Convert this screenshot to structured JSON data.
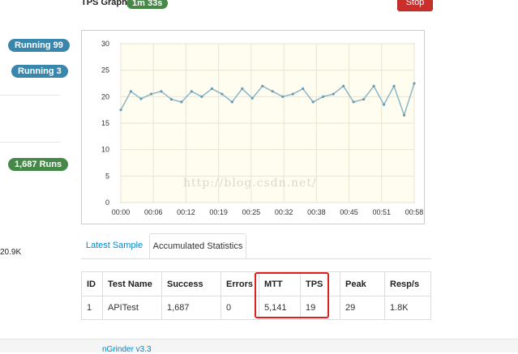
{
  "sidebar": {
    "running_badge_1": "Running 99",
    "running_badge_2": "Running 3",
    "runs_badge": "1,687  Runs",
    "size_text": "20.9K"
  },
  "graph": {
    "title": "TPS Graph",
    "elapsed": "1m 33s",
    "stop_label": "Stop",
    "watermark": "http://blog.csdn.net/"
  },
  "chart_data": {
    "type": "line",
    "ylim": [
      0,
      30
    ],
    "yticks": [
      "0",
      "5",
      "10",
      "15",
      "20",
      "25",
      "30"
    ],
    "xticks": [
      "00:00",
      "00:06",
      "00:12",
      "00:19",
      "00:25",
      "00:32",
      "00:38",
      "00:45",
      "00:51",
      "00:58"
    ],
    "series": [
      {
        "values": [
          17.5,
          21,
          19.6,
          20.5,
          21,
          19.5,
          19,
          21,
          20,
          21.5,
          20.5,
          19,
          21.5,
          19.7,
          22,
          21,
          20,
          20.5,
          21.5,
          19,
          20,
          20.5,
          22,
          19,
          19.5,
          22,
          18.5,
          22,
          16.5,
          22.5
        ]
      }
    ],
    "colors": {
      "line": "#8ab6c8",
      "plot_bg": "#fffdf0",
      "grid": "#e8e4d0"
    }
  },
  "tabs": [
    {
      "label": "Latest Sample"
    },
    {
      "label": "Accumulated Statistics"
    }
  ],
  "table": {
    "headers": [
      "ID",
      "Test Name",
      "Success",
      "Errors",
      "MTT",
      "TPS",
      "Peak",
      "Resp/s"
    ],
    "rows": [
      [
        "1",
        "APITest",
        "1,687",
        "0",
        "5,141",
        "19",
        "29",
        "1.8K"
      ]
    ]
  },
  "footer": {
    "link": "nGrinder v3.3"
  }
}
